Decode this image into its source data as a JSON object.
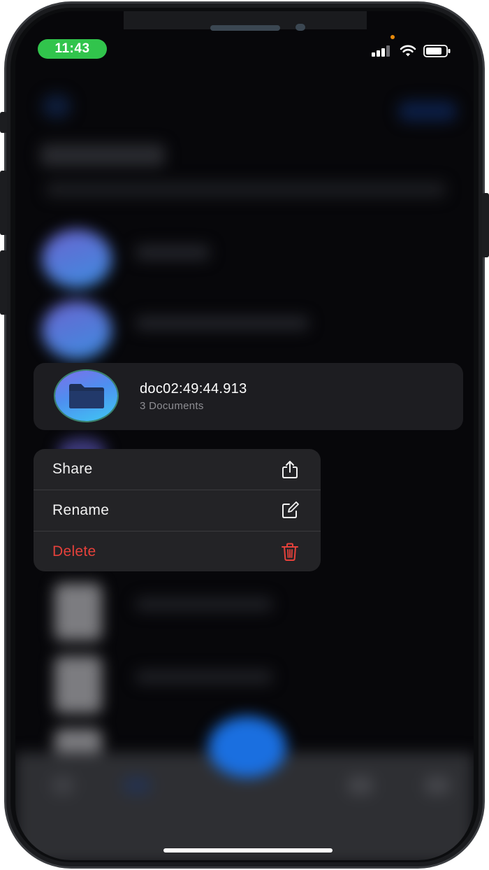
{
  "status_bar": {
    "time": "11:43"
  },
  "context": {
    "folder": {
      "title": "doc02:49:44.913",
      "subtitle": "3 Documents"
    },
    "menu": [
      {
        "label": "Share",
        "icon": "share-icon",
        "destructive": false
      },
      {
        "label": "Rename",
        "icon": "edit-icon",
        "destructive": false
      },
      {
        "label": "Delete",
        "icon": "trash-icon",
        "destructive": true
      }
    ]
  },
  "colors": {
    "time_pill": "#31c44c",
    "destructive": "#e5413b",
    "menu_background": "#232326",
    "card_background": "#1d1d21"
  }
}
